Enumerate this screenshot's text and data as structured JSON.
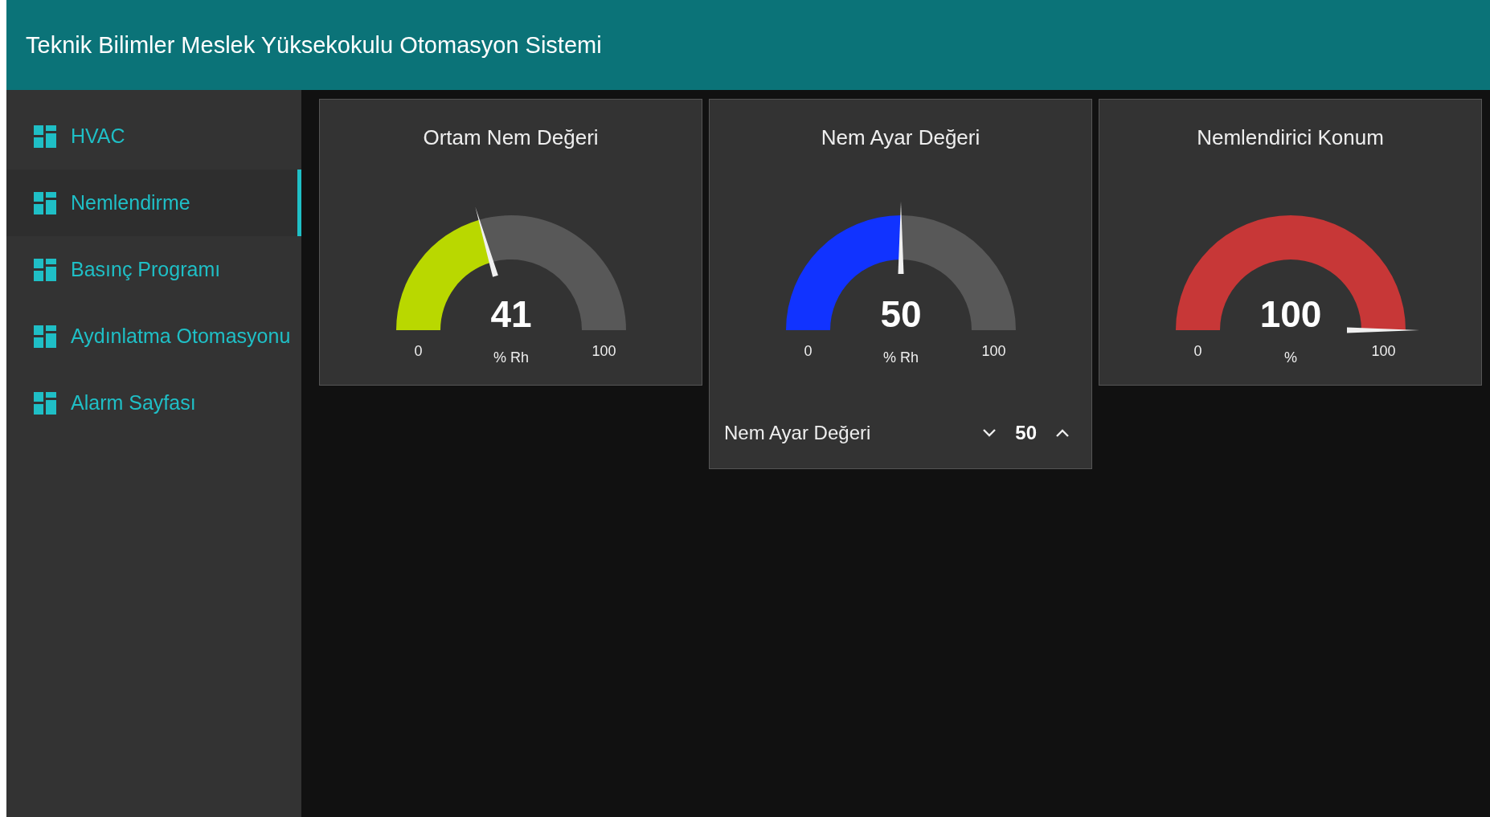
{
  "header": {
    "title": "Teknik Bilimler Meslek Yüksekokulu Otomasyon Sistemi"
  },
  "sidebar": {
    "items": [
      {
        "label": "HVAC",
        "selected": false
      },
      {
        "label": "Nemlendirme",
        "selected": true
      },
      {
        "label": "Basınç Programı",
        "selected": false
      },
      {
        "label": "Aydınlatma Otomasyonu",
        "selected": false
      },
      {
        "label": "Alarm Sayfası",
        "selected": false
      }
    ]
  },
  "cards": [
    {
      "title": "Ortam Nem Değeri",
      "gauge": {
        "value": "41",
        "unit": "% Rh",
        "min": "0",
        "max": "100",
        "color": "#b9d800"
      }
    },
    {
      "title": "Nem Ayar Değeri",
      "gauge": {
        "value": "50",
        "unit": "% Rh",
        "min": "0",
        "max": "100",
        "color": "#1133ff"
      },
      "numeric": {
        "label": "Nem Ayar Değeri",
        "value": "50"
      }
    },
    {
      "title": "Nemlendirici Konum",
      "gauge": {
        "value": "100",
        "unit": "%",
        "min": "0",
        "max": "100",
        "color": "#c73737"
      }
    }
  ]
}
